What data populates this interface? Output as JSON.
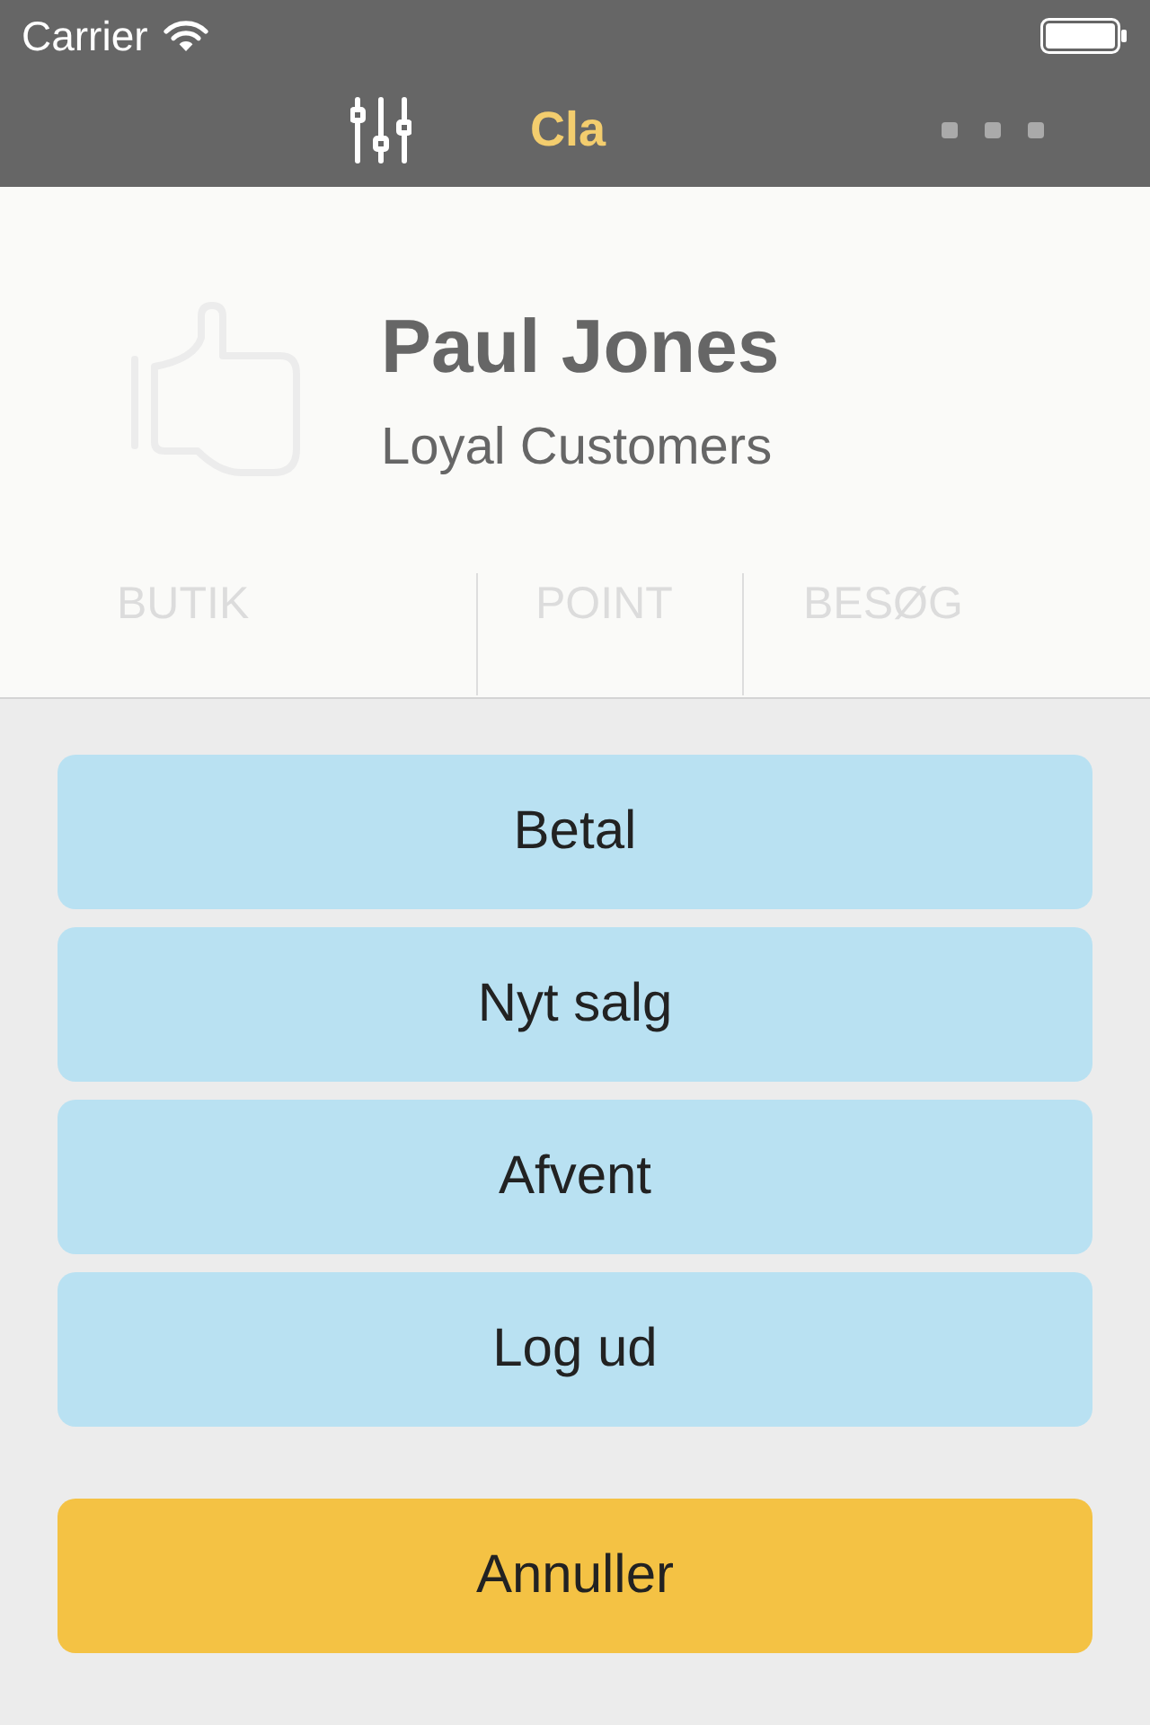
{
  "status_bar": {
    "carrier": "Carrier"
  },
  "nav_bar": {
    "title": "Cla"
  },
  "profile": {
    "name": "Paul Jones",
    "group": "Loyal Customers"
  },
  "stats": [
    {
      "label": "BUTIK"
    },
    {
      "label": "POINT"
    },
    {
      "label": "BESØG"
    }
  ],
  "action_sheet": {
    "actions": [
      {
        "label": "Betal",
        "kind": "default"
      },
      {
        "label": "Nyt salg",
        "kind": "default"
      },
      {
        "label": "Afvent",
        "kind": "default"
      },
      {
        "label": "Log ud",
        "kind": "default"
      },
      {
        "label": "Annuller",
        "kind": "cancel"
      }
    ]
  }
}
